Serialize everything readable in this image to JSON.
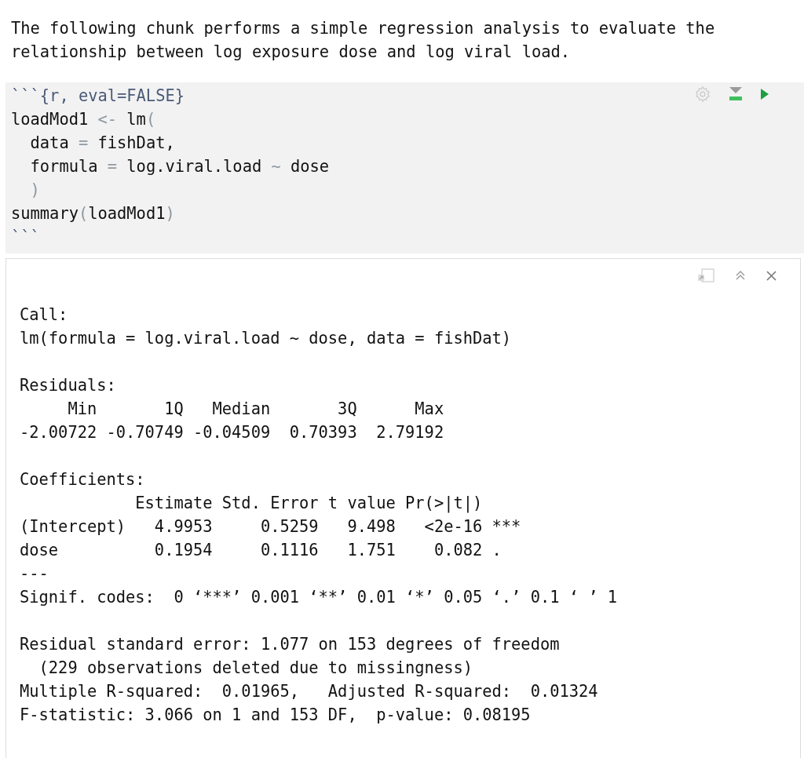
{
  "prose": {
    "lines": [
      "The following chunk performs a simple regression analysis to evaluate the",
      "relationship between log exposure dose and log viral load."
    ]
  },
  "chunk": {
    "lines": [
      [
        {
          "kind": "header",
          "text": "```{r, eval=FALSE}"
        }
      ],
      [
        {
          "kind": "code",
          "text": "loadMod1 "
        },
        {
          "kind": "op",
          "text": "<-"
        },
        {
          "kind": "code",
          "text": " lm"
        },
        {
          "kind": "op",
          "text": "("
        }
      ],
      [
        {
          "kind": "code",
          "text": "  data "
        },
        {
          "kind": "op",
          "text": "="
        },
        {
          "kind": "code",
          "text": " fishDat,"
        }
      ],
      [
        {
          "kind": "code",
          "text": "  formula "
        },
        {
          "kind": "op",
          "text": "="
        },
        {
          "kind": "code",
          "text": " log.viral.load "
        },
        {
          "kind": "op",
          "text": "~"
        },
        {
          "kind": "code",
          "text": " dose"
        }
      ],
      [
        {
          "kind": "op",
          "text": "  )"
        }
      ],
      [
        {
          "kind": "code",
          "text": "summary"
        },
        {
          "kind": "op",
          "text": "("
        },
        {
          "kind": "code",
          "text": "loadMod1"
        },
        {
          "kind": "op",
          "text": ")"
        }
      ],
      [
        {
          "kind": "header",
          "text": "```"
        }
      ]
    ]
  },
  "output": {
    "blocks": [
      [
        "Call:",
        "lm(formula = log.viral.load ~ dose, data = fishDat)"
      ],
      [
        "Residuals:",
        "     Min       1Q   Median       3Q      Max ",
        "-2.00722 -0.70749 -0.04509  0.70393  2.79192 "
      ],
      [
        "Coefficients:",
        "            Estimate Std. Error t value Pr(>|t|)    ",
        "(Intercept)   4.9953     0.5259   9.498   <2e-16 ***",
        "dose          0.1954     0.1116   1.751    0.082 .  ",
        "---",
        "Signif. codes:  0 ‘***’ 0.001 ‘**’ 0.01 ‘*’ 0.05 ‘.’ 0.1 ‘ ’ 1"
      ],
      [
        "Residual standard error: 1.077 on 153 degrees of freedom",
        "  (229 observations deleted due to missingness)",
        "Multiple R-squared:  0.01965,\tAdjusted R-squared:  0.01324 ",
        "F-statistic: 3.066 on 1 and 153 DF,  p-value: 0.08195"
      ]
    ]
  }
}
